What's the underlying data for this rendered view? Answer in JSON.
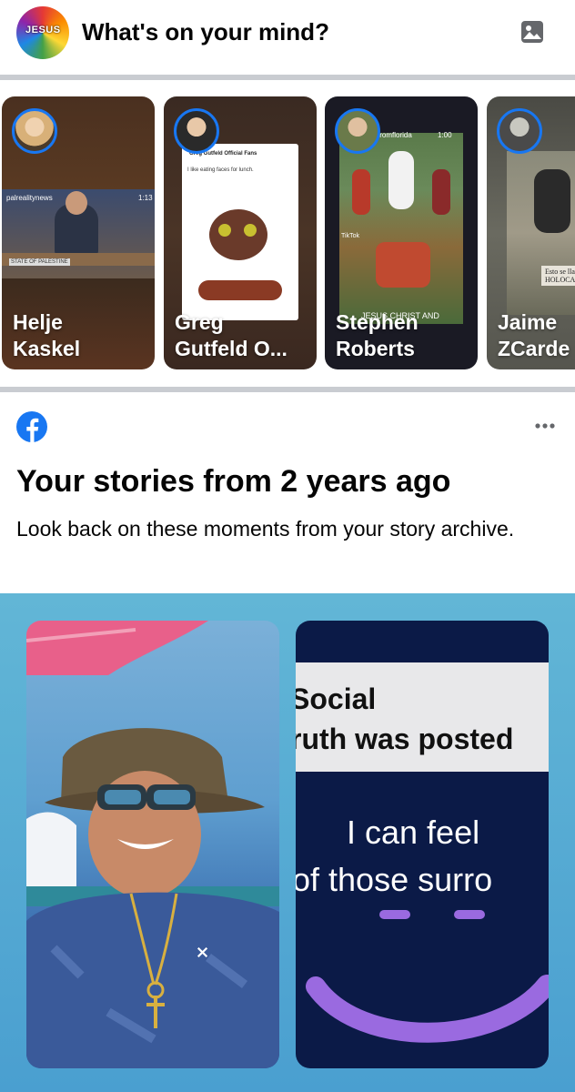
{
  "composer": {
    "avatar_text": "JESUS",
    "prompt": "What's on your mind?"
  },
  "stories": [
    {
      "name": "Helje\nKaskel",
      "overlay": "palrealitynews",
      "time": "1:13",
      "caption": "STATE OF PALESTINE"
    },
    {
      "name": "Greg\nGutfeld O...",
      "post_author": "Greg Gutfeld Official Fans",
      "post_text": "I like eating faces for lunch."
    },
    {
      "name": "Stephen\nRoberts",
      "overlay": "fromflorida",
      "time": "1:00",
      "caption": "JESUS CHRIST AND",
      "tiktok": "TikTok"
    },
    {
      "name": "Jaime\nZCarde",
      "caption_lines": [
        "Esto se lla",
        "HOLOCAU"
      ]
    }
  ],
  "memory": {
    "title": "Your stories from 2 years ago",
    "subtitle": "Look back on these moments from your story archive."
  },
  "memory_cards": [
    {
      "kind": "photo"
    },
    {
      "lines": [
        "Social",
        "ruth was posted"
      ],
      "lines2": [
        "I can feel",
        "of those surro"
      ]
    }
  ],
  "colors": {
    "accent": "#1877f2",
    "divider": "#c9ccd1",
    "memory_bg": "#5aaed5"
  },
  "icons": {
    "photo": "photo-icon",
    "facebook": "facebook-logo-icon",
    "more": "more-icon"
  }
}
